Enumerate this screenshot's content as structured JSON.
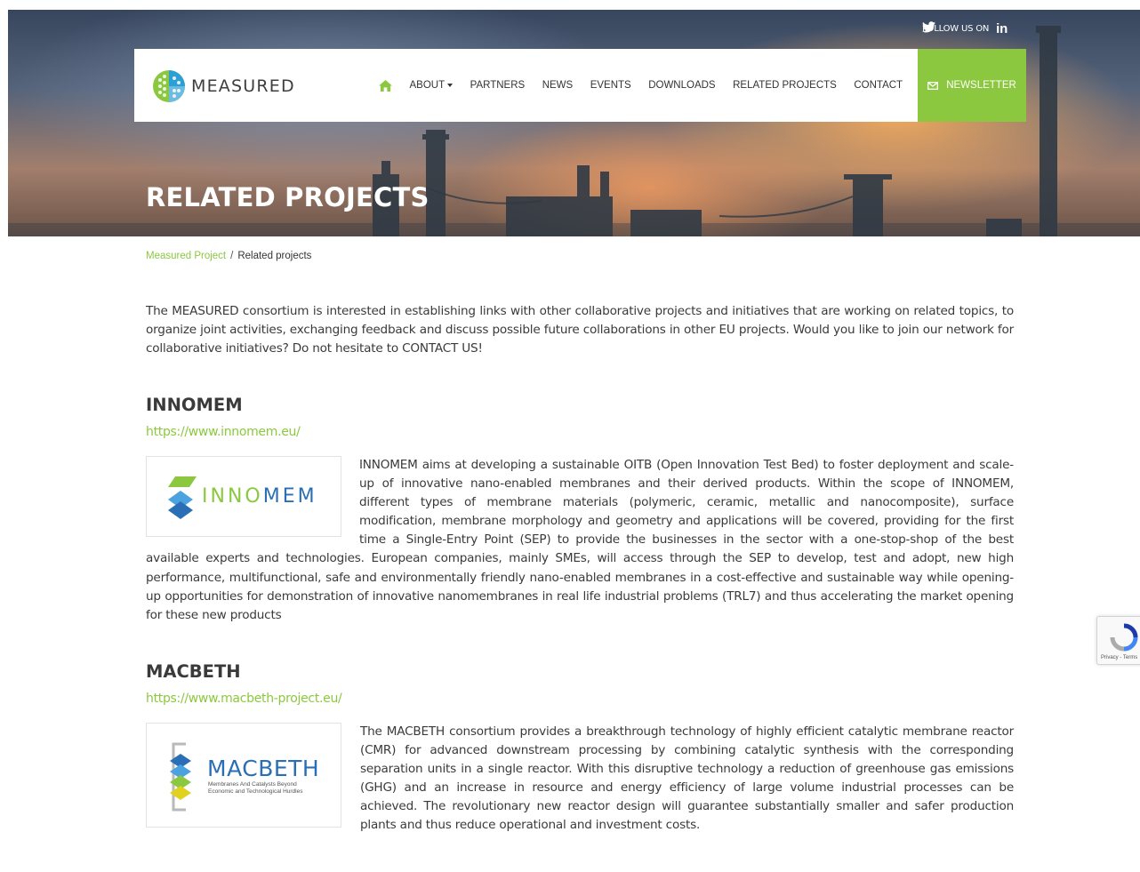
{
  "header": {
    "follow_label": "FOLLOW US ON",
    "linkedin_label": "in",
    "page_title": "RELATED PROJECTS"
  },
  "logo": {
    "text": "MEASURED"
  },
  "nav": {
    "items": [
      "ABOUT",
      "PARTNERS",
      "NEWS",
      "EVENTS",
      "DOWNLOADS",
      "RELATED PROJECTS",
      "CONTACT"
    ],
    "newsletter": "NEWSLETTER"
  },
  "breadcrumb": {
    "home": "Measured Project",
    "separator": "/",
    "current": "Related projects"
  },
  "intro": "The MEASURED consortium is interested in establishing links with other collaborative projects and initiatives that are working on related topics, to organize joint activities, exchanging feedback and discuss possible future collaborations in other EU projects. Would you like to join our network for collaborative initiatives? Do not hesitate to CONTACT US!",
  "projects": [
    {
      "title": "INNOMEM",
      "url": "https://www.innomem.eu/",
      "logo_text_a": "INNO",
      "logo_text_b": "MEM",
      "description": "INNOMEM aims at developing a sustainable OITB (Open Innovation Test Bed) to foster deployment and scale-up of innovative nano-enabled membranes and their derived products. Within the scope of INNOMEM, different types of membrane materials (polymeric, ceramic, metallic and nanocomposite), surface modification, membrane morphology and geometry and applications will be covered, providing for the first time a Single-Entry Point (SEP) to provide the businesses in the sector with a one-stop-shop of the best available experts and technologies. European companies, mainly SMEs, will access through the SEP to develop, test and adopt, new high performance, multifunctional, safe and environmentally friendly nano-enabled membranes in a cost-effective and sustainable way while opening-up opportunities for demonstration of innovative nanomembranes in real life industrial problems (TRL7) and thus accelerating the market opening for these new products"
    },
    {
      "title": "MACBETH",
      "url": "https://www.macbeth-project.eu/",
      "logo_text": "MACBETH",
      "logo_sub1": "Membranes And Catalysts Beyond",
      "logo_sub2": "Economic and Technological Hurdles",
      "description": "The MACBETH consortium provides a breakthrough technology of highly efficient catalytic membrane reactor (CMR) for advanced downstream processing by combining catalytic synthesis with the corresponding separation units in a single reactor. With this disruptive technology a reduction of greenhouse gas emissions (GHG) and an increase in resource and energy efficiency of large volume industrial processes can be achieved. The revolutionary new reactor design will guarantee substantially smaller and safer production plants and thus reduce operational and investment costs."
    }
  ],
  "recaptcha": {
    "label": "Privacy - Terms"
  },
  "colors": {
    "accent": "#8cc83f",
    "text": "#3a3a3a"
  }
}
